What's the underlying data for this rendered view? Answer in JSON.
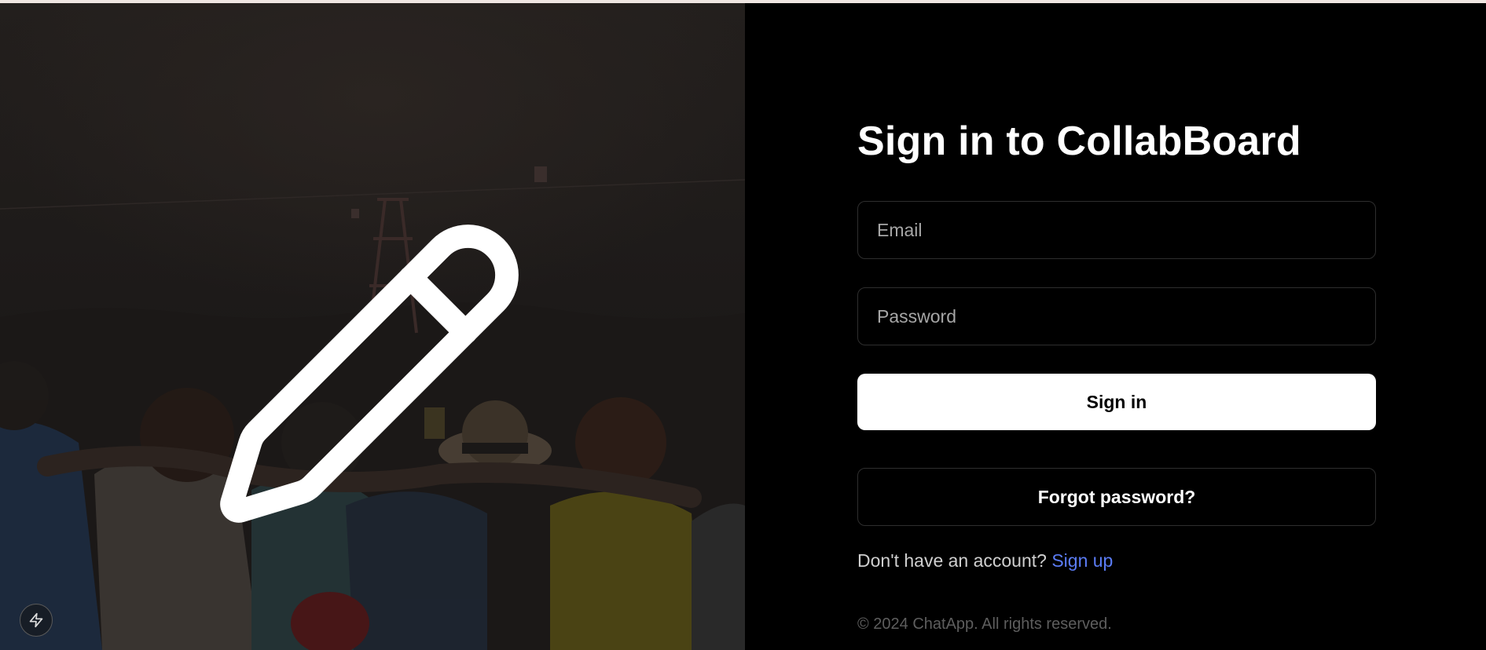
{
  "auth": {
    "title": "Sign in to CollabBoard",
    "email_placeholder": "Email",
    "password_placeholder": "Password",
    "signin_label": "Sign in",
    "forgot_label": "Forgot password?",
    "signup_prompt": "Don't have an account?",
    "signup_link": "Sign up",
    "copyright": "© 2024 ChatApp. All rights reserved."
  },
  "hero": {
    "logo_icon": "pencil-icon",
    "background": "group-of-friends-photo",
    "corner_icon": "lightning-icon"
  },
  "colors": {
    "background": "#000000",
    "primary_button": "#ffffff",
    "link": "#5b7cf5",
    "border": "#2e2e2e",
    "muted_text": "#5e5e5e"
  }
}
